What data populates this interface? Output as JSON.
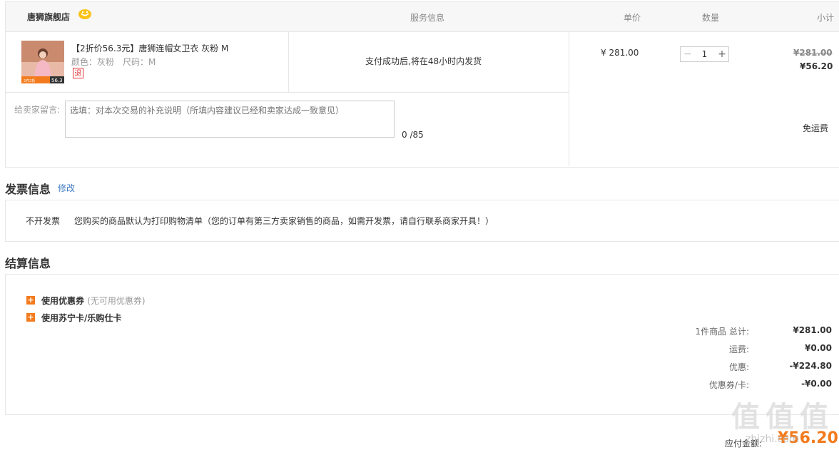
{
  "order": {
    "store_name": "唐狮旗舰店",
    "headers": {
      "service": "服务信息",
      "unit_price": "单价",
      "quantity": "数量",
      "subtotal": "小计"
    },
    "product": {
      "title": "【2折价56.3元】唐狮连帽女卫衣 灰粉 M",
      "attributes": "颜色：灰粉　尺码：M",
      "refund_badge": "退",
      "image_price_tag": "56.3",
      "image_tag_text": "2件2折"
    },
    "service_text": "支付成功后,将在48小时内发货",
    "unit_price": "¥ 281.00",
    "quantity": "1",
    "subtotal_original": "¥281.00",
    "subtotal_final": "¥56.20",
    "message_label": "给卖家留言:",
    "message_placeholder": "选填：对本次交易的补充说明（所填内容建议已经和卖家达成一致意见）",
    "message_count": "0 /85",
    "shipping": "免运费"
  },
  "invoice": {
    "title": "发票信息",
    "edit_label": "修改",
    "type": "不开发票",
    "description": "您购买的商品默认为打印购物清单（您的订单有第三方卖家销售的商品，如需开发票，请自行联系商家开具！）"
  },
  "settlement": {
    "title": "结算信息",
    "coupon_label": "使用优惠券",
    "coupon_note": "(无可用优惠券)",
    "card_label": "使用苏宁卡/乐购仕卡",
    "summary": [
      {
        "label": "1件商品 总计:",
        "value": "¥281.00"
      },
      {
        "label": "运费:",
        "value": "¥0.00"
      },
      {
        "label": "优惠:",
        "value": "-¥224.80"
      },
      {
        "label": "优惠券/卡:",
        "value": "-¥0.00"
      }
    ],
    "payable_label": "应付金额:",
    "payable_value": "¥56.20"
  },
  "watermark_text": "值",
  "watermark_url": "zhizhi.com",
  "colors": {
    "accent": "#f37b1d",
    "link": "#3a78c3",
    "border": "#e6e6e6"
  }
}
